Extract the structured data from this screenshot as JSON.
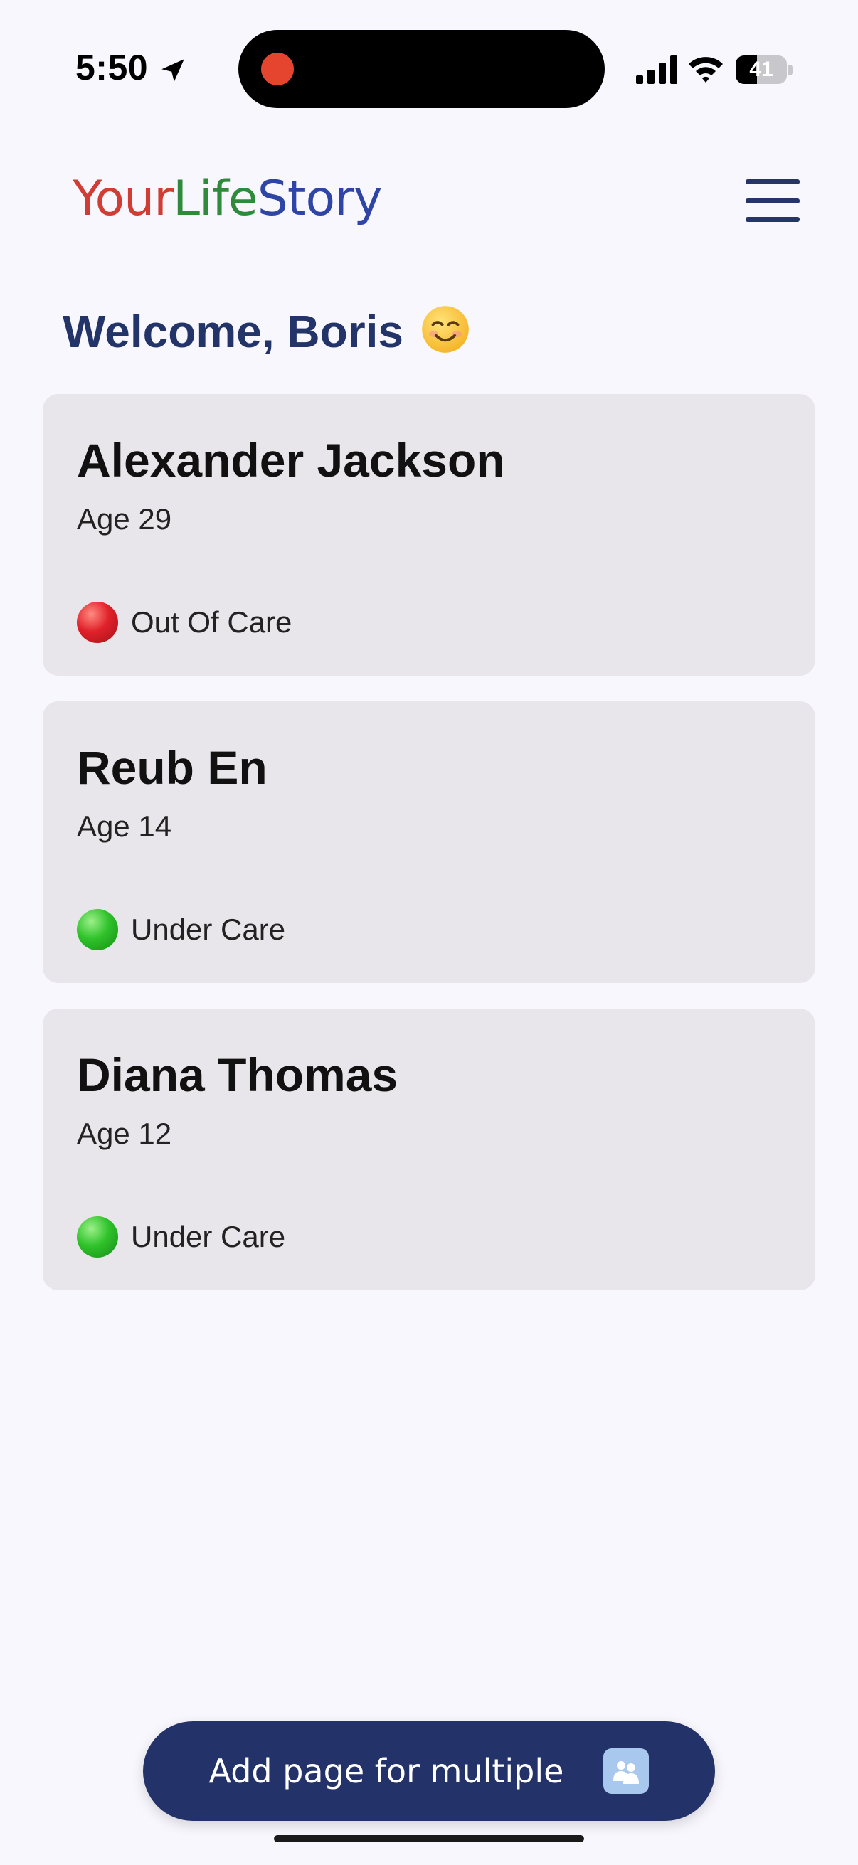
{
  "status_bar": {
    "time": "5:50",
    "battery_level": "41",
    "icons": [
      "location-arrow-icon",
      "signal-icon",
      "wifi-icon",
      "battery-icon"
    ]
  },
  "header": {
    "logo_part1": "Your",
    "logo_part2": "Life",
    "logo_part3": "Story",
    "menu_icon": "hamburger-menu-icon"
  },
  "welcome": {
    "text": "Welcome, Boris",
    "emoji_icon": "smiling-face-icon"
  },
  "people": [
    {
      "name": "Alexander Jackson",
      "age": "Age 29",
      "status": "Out Of Care",
      "status_color": "red"
    },
    {
      "name": "Reub En",
      "age": "Age 14",
      "status": "Under Care",
      "status_color": "green"
    },
    {
      "name": "Diana Thomas",
      "age": "Age 12",
      "status": "Under Care",
      "status_color": "green"
    }
  ],
  "add_button": {
    "label": "Add page for multiple",
    "icon": "people-icon"
  },
  "colors": {
    "background": "#f8f7fd",
    "navy": "#233268",
    "card": "#e8e6eb",
    "logo_red": "#cf3d34",
    "logo_green": "#2f8b3b",
    "logo_blue": "#2f45a6"
  }
}
